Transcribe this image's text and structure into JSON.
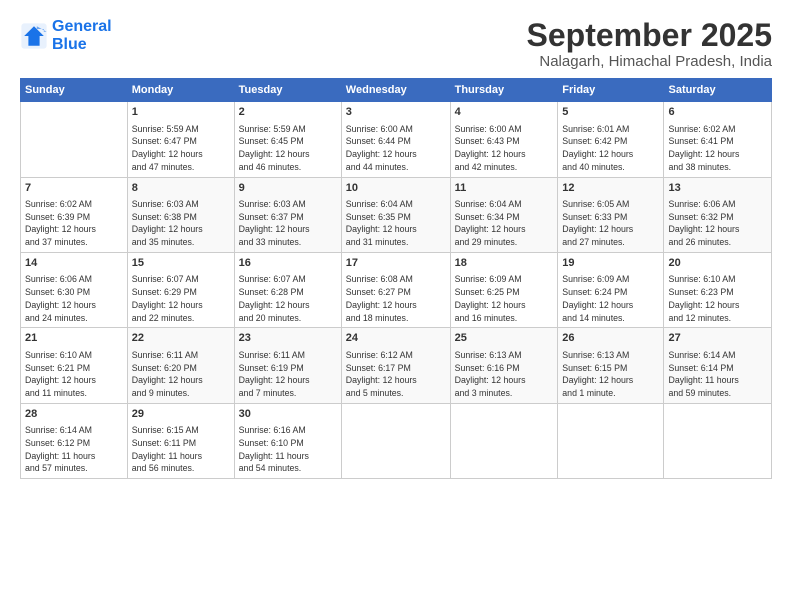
{
  "logo": {
    "line1": "General",
    "line2": "Blue"
  },
  "title": "September 2025",
  "subtitle": "Nalagarh, Himachal Pradesh, India",
  "headers": [
    "Sunday",
    "Monday",
    "Tuesday",
    "Wednesday",
    "Thursday",
    "Friday",
    "Saturday"
  ],
  "weeks": [
    [
      {
        "day": "",
        "info": ""
      },
      {
        "day": "1",
        "info": "Sunrise: 5:59 AM\nSunset: 6:47 PM\nDaylight: 12 hours\nand 47 minutes."
      },
      {
        "day": "2",
        "info": "Sunrise: 5:59 AM\nSunset: 6:45 PM\nDaylight: 12 hours\nand 46 minutes."
      },
      {
        "day": "3",
        "info": "Sunrise: 6:00 AM\nSunset: 6:44 PM\nDaylight: 12 hours\nand 44 minutes."
      },
      {
        "day": "4",
        "info": "Sunrise: 6:00 AM\nSunset: 6:43 PM\nDaylight: 12 hours\nand 42 minutes."
      },
      {
        "day": "5",
        "info": "Sunrise: 6:01 AM\nSunset: 6:42 PM\nDaylight: 12 hours\nand 40 minutes."
      },
      {
        "day": "6",
        "info": "Sunrise: 6:02 AM\nSunset: 6:41 PM\nDaylight: 12 hours\nand 38 minutes."
      }
    ],
    [
      {
        "day": "7",
        "info": "Sunrise: 6:02 AM\nSunset: 6:39 PM\nDaylight: 12 hours\nand 37 minutes."
      },
      {
        "day": "8",
        "info": "Sunrise: 6:03 AM\nSunset: 6:38 PM\nDaylight: 12 hours\nand 35 minutes."
      },
      {
        "day": "9",
        "info": "Sunrise: 6:03 AM\nSunset: 6:37 PM\nDaylight: 12 hours\nand 33 minutes."
      },
      {
        "day": "10",
        "info": "Sunrise: 6:04 AM\nSunset: 6:35 PM\nDaylight: 12 hours\nand 31 minutes."
      },
      {
        "day": "11",
        "info": "Sunrise: 6:04 AM\nSunset: 6:34 PM\nDaylight: 12 hours\nand 29 minutes."
      },
      {
        "day": "12",
        "info": "Sunrise: 6:05 AM\nSunset: 6:33 PM\nDaylight: 12 hours\nand 27 minutes."
      },
      {
        "day": "13",
        "info": "Sunrise: 6:06 AM\nSunset: 6:32 PM\nDaylight: 12 hours\nand 26 minutes."
      }
    ],
    [
      {
        "day": "14",
        "info": "Sunrise: 6:06 AM\nSunset: 6:30 PM\nDaylight: 12 hours\nand 24 minutes."
      },
      {
        "day": "15",
        "info": "Sunrise: 6:07 AM\nSunset: 6:29 PM\nDaylight: 12 hours\nand 22 minutes."
      },
      {
        "day": "16",
        "info": "Sunrise: 6:07 AM\nSunset: 6:28 PM\nDaylight: 12 hours\nand 20 minutes."
      },
      {
        "day": "17",
        "info": "Sunrise: 6:08 AM\nSunset: 6:27 PM\nDaylight: 12 hours\nand 18 minutes."
      },
      {
        "day": "18",
        "info": "Sunrise: 6:09 AM\nSunset: 6:25 PM\nDaylight: 12 hours\nand 16 minutes."
      },
      {
        "day": "19",
        "info": "Sunrise: 6:09 AM\nSunset: 6:24 PM\nDaylight: 12 hours\nand 14 minutes."
      },
      {
        "day": "20",
        "info": "Sunrise: 6:10 AM\nSunset: 6:23 PM\nDaylight: 12 hours\nand 12 minutes."
      }
    ],
    [
      {
        "day": "21",
        "info": "Sunrise: 6:10 AM\nSunset: 6:21 PM\nDaylight: 12 hours\nand 11 minutes."
      },
      {
        "day": "22",
        "info": "Sunrise: 6:11 AM\nSunset: 6:20 PM\nDaylight: 12 hours\nand 9 minutes."
      },
      {
        "day": "23",
        "info": "Sunrise: 6:11 AM\nSunset: 6:19 PM\nDaylight: 12 hours\nand 7 minutes."
      },
      {
        "day": "24",
        "info": "Sunrise: 6:12 AM\nSunset: 6:17 PM\nDaylight: 12 hours\nand 5 minutes."
      },
      {
        "day": "25",
        "info": "Sunrise: 6:13 AM\nSunset: 6:16 PM\nDaylight: 12 hours\nand 3 minutes."
      },
      {
        "day": "26",
        "info": "Sunrise: 6:13 AM\nSunset: 6:15 PM\nDaylight: 12 hours\nand 1 minute."
      },
      {
        "day": "27",
        "info": "Sunrise: 6:14 AM\nSunset: 6:14 PM\nDaylight: 11 hours\nand 59 minutes."
      }
    ],
    [
      {
        "day": "28",
        "info": "Sunrise: 6:14 AM\nSunset: 6:12 PM\nDaylight: 11 hours\nand 57 minutes."
      },
      {
        "day": "29",
        "info": "Sunrise: 6:15 AM\nSunset: 6:11 PM\nDaylight: 11 hours\nand 56 minutes."
      },
      {
        "day": "30",
        "info": "Sunrise: 6:16 AM\nSunset: 6:10 PM\nDaylight: 11 hours\nand 54 minutes."
      },
      {
        "day": "",
        "info": ""
      },
      {
        "day": "",
        "info": ""
      },
      {
        "day": "",
        "info": ""
      },
      {
        "day": "",
        "info": ""
      }
    ]
  ]
}
